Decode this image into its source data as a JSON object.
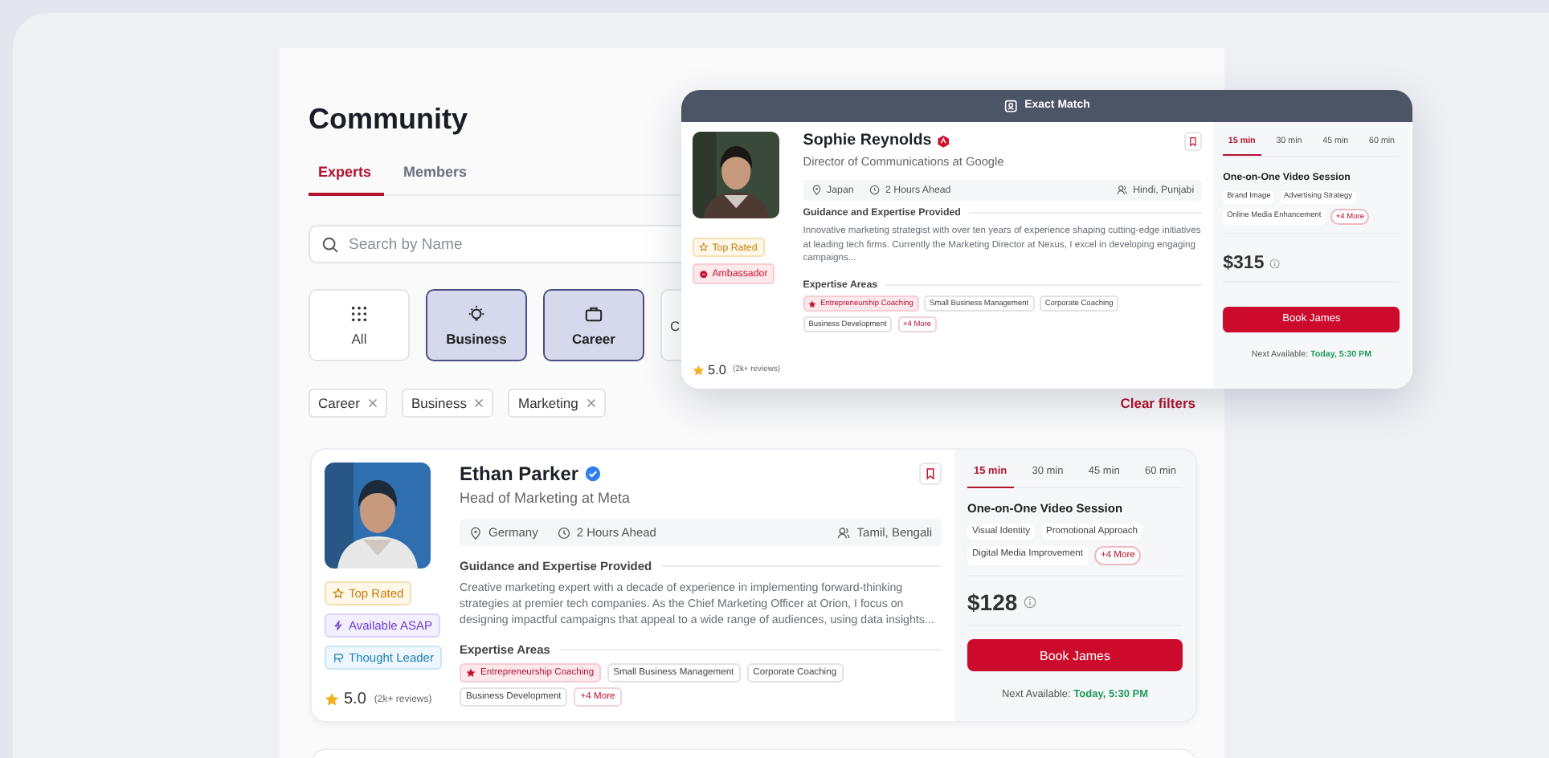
{
  "page": {
    "title": "Community"
  },
  "tabs": [
    {
      "label": "Experts",
      "selected": true
    },
    {
      "label": "Members",
      "selected": false
    }
  ],
  "search": {
    "placeholder": "Search by Name"
  },
  "categories": [
    {
      "label": "All",
      "selected": false
    },
    {
      "label": "Business",
      "selected": true
    },
    {
      "label": "Career",
      "selected": true
    },
    {
      "label": "C",
      "selected": false
    }
  ],
  "filters": [
    {
      "label": "Career"
    },
    {
      "label": "Business"
    },
    {
      "label": "Marketing"
    }
  ],
  "clear_filters": "Clear filters",
  "match": {
    "banner": "Exact Match",
    "expert": {
      "name": "Sophie Reynolds",
      "name_badge": {
        "kind": "ambassador"
      },
      "title": "Director of Communications at Google",
      "country": "Japan",
      "time_offset": "2 Hours Ahead",
      "languages": "Hindi, Punjabi",
      "guidance_heading": "Guidance and Expertise Provided",
      "bio": "Innovative marketing strategist with over ten years of experience shaping cutting-edge initiatives at leading tech firms. Currently the Marketing Director at Nexus, I excel in developing engaging campaigns...",
      "expertise_heading": "Expertise Areas",
      "expertise": [
        {
          "label": "Entrepreneurship Coaching",
          "featured": true
        },
        {
          "label": "Small Business Management",
          "featured": false
        },
        {
          "label": "Corporate Coaching",
          "featured": false
        },
        {
          "label": "Business Development",
          "featured": false
        }
      ],
      "expertise_more": "+4 More",
      "tags": [
        {
          "label": "Top Rated",
          "kind": "top-rated"
        },
        {
          "label": "Ambassador",
          "kind": "ambassador"
        }
      ],
      "rating": "5.0",
      "reviews": "(2k+ reviews)",
      "photo": {
        "kind": "picture"
      },
      "session": {
        "durations": [
          {
            "label": "15 min",
            "selected": true
          },
          {
            "label": "30 min",
            "selected": false
          },
          {
            "label": "45 min",
            "selected": false
          },
          {
            "label": "60 min",
            "selected": false
          }
        ],
        "title": "One-on-One Video Session",
        "topics": [
          "Brand Image",
          "Advertising Strategy",
          "Online Media Enhancement"
        ],
        "topics_more": "+4 More",
        "price": "$315",
        "button": "Book James",
        "next_label": "Next Available:",
        "next_time": "Today, 5:30 PM"
      }
    }
  },
  "experts": [
    {
      "name": "Ethan Parker",
      "name_badge": {
        "kind": "verified"
      },
      "title": "Head of Marketing at Meta",
      "country": "Germany",
      "time_offset": "2 Hours Ahead",
      "languages": "Tamil, Bengali",
      "guidance_heading": "Guidance and Expertise Provided",
      "bio": "Creative marketing expert with a decade of experience in implementing forward-thinking strategies at premier tech companies. As the Chief Marketing Officer at Orion, I focus on designing impactful campaigns that appeal to a wide range of audiences, using data insights...",
      "expertise_heading": "Expertise Areas",
      "expertise": [
        {
          "label": "Entrepreneurship Coaching",
          "featured": true
        },
        {
          "label": "Small Business Management",
          "featured": false
        },
        {
          "label": "Corporate Coaching",
          "featured": false
        },
        {
          "label": "Business Development",
          "featured": false
        }
      ],
      "expertise_more": "+4 More",
      "tags": [
        {
          "label": "Top Rated",
          "kind": "top-rated"
        },
        {
          "label": "Available ASAP",
          "kind": "available"
        },
        {
          "label": "Thought Leader",
          "kind": "thought-leader"
        }
      ],
      "rating": "5.0",
      "reviews": "(2k+ reviews)",
      "photo": {
        "kind": "picture"
      },
      "session": {
        "durations": [
          {
            "label": "15 min",
            "selected": true
          },
          {
            "label": "30 min",
            "selected": false
          },
          {
            "label": "45 min",
            "selected": false
          },
          {
            "label": "60 min",
            "selected": false
          }
        ],
        "title": "One-on-One Video Session",
        "topics": [
          "Visual Identity",
          "Promotional Approach",
          "Digital Media Improvement"
        ],
        "topics_more": "+4 More",
        "price": "$128",
        "button": "Book James",
        "next_label": "Next Available:",
        "next_time": "Today, 5:30 PM"
      }
    }
  ]
}
